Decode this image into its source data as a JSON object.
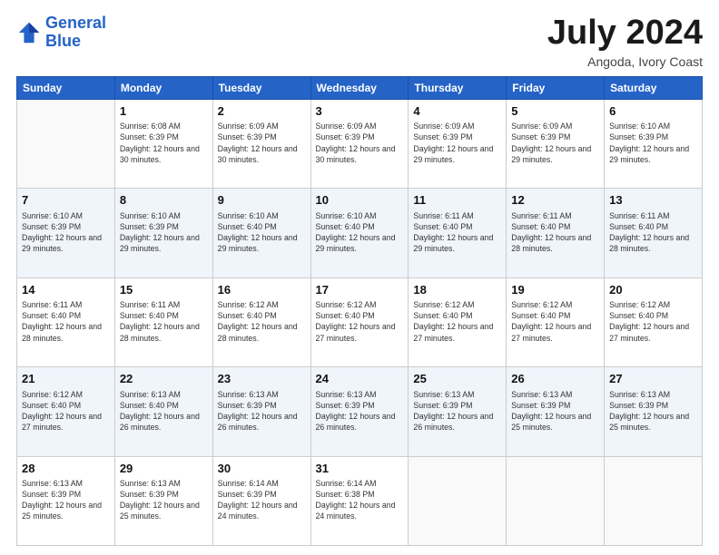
{
  "logo": {
    "line1": "General",
    "line2": "Blue"
  },
  "header": {
    "month": "July 2024",
    "location": "Angoda, Ivory Coast"
  },
  "weekdays": [
    "Sunday",
    "Monday",
    "Tuesday",
    "Wednesday",
    "Thursday",
    "Friday",
    "Saturday"
  ],
  "weeks": [
    [
      {
        "day": null
      },
      {
        "day": 1,
        "sunrise": "6:08 AM",
        "sunset": "6:39 PM",
        "daylight": "12 hours and 30 minutes."
      },
      {
        "day": 2,
        "sunrise": "6:09 AM",
        "sunset": "6:39 PM",
        "daylight": "12 hours and 30 minutes."
      },
      {
        "day": 3,
        "sunrise": "6:09 AM",
        "sunset": "6:39 PM",
        "daylight": "12 hours and 30 minutes."
      },
      {
        "day": 4,
        "sunrise": "6:09 AM",
        "sunset": "6:39 PM",
        "daylight": "12 hours and 29 minutes."
      },
      {
        "day": 5,
        "sunrise": "6:09 AM",
        "sunset": "6:39 PM",
        "daylight": "12 hours and 29 minutes."
      },
      {
        "day": 6,
        "sunrise": "6:10 AM",
        "sunset": "6:39 PM",
        "daylight": "12 hours and 29 minutes."
      }
    ],
    [
      {
        "day": 7,
        "sunrise": "6:10 AM",
        "sunset": "6:39 PM",
        "daylight": "12 hours and 29 minutes."
      },
      {
        "day": 8,
        "sunrise": "6:10 AM",
        "sunset": "6:39 PM",
        "daylight": "12 hours and 29 minutes."
      },
      {
        "day": 9,
        "sunrise": "6:10 AM",
        "sunset": "6:40 PM",
        "daylight": "12 hours and 29 minutes."
      },
      {
        "day": 10,
        "sunrise": "6:10 AM",
        "sunset": "6:40 PM",
        "daylight": "12 hours and 29 minutes."
      },
      {
        "day": 11,
        "sunrise": "6:11 AM",
        "sunset": "6:40 PM",
        "daylight": "12 hours and 29 minutes."
      },
      {
        "day": 12,
        "sunrise": "6:11 AM",
        "sunset": "6:40 PM",
        "daylight": "12 hours and 28 minutes."
      },
      {
        "day": 13,
        "sunrise": "6:11 AM",
        "sunset": "6:40 PM",
        "daylight": "12 hours and 28 minutes."
      }
    ],
    [
      {
        "day": 14,
        "sunrise": "6:11 AM",
        "sunset": "6:40 PM",
        "daylight": "12 hours and 28 minutes."
      },
      {
        "day": 15,
        "sunrise": "6:11 AM",
        "sunset": "6:40 PM",
        "daylight": "12 hours and 28 minutes."
      },
      {
        "day": 16,
        "sunrise": "6:12 AM",
        "sunset": "6:40 PM",
        "daylight": "12 hours and 28 minutes."
      },
      {
        "day": 17,
        "sunrise": "6:12 AM",
        "sunset": "6:40 PM",
        "daylight": "12 hours and 27 minutes."
      },
      {
        "day": 18,
        "sunrise": "6:12 AM",
        "sunset": "6:40 PM",
        "daylight": "12 hours and 27 minutes."
      },
      {
        "day": 19,
        "sunrise": "6:12 AM",
        "sunset": "6:40 PM",
        "daylight": "12 hours and 27 minutes."
      },
      {
        "day": 20,
        "sunrise": "6:12 AM",
        "sunset": "6:40 PM",
        "daylight": "12 hours and 27 minutes."
      }
    ],
    [
      {
        "day": 21,
        "sunrise": "6:12 AM",
        "sunset": "6:40 PM",
        "daylight": "12 hours and 27 minutes."
      },
      {
        "day": 22,
        "sunrise": "6:13 AM",
        "sunset": "6:40 PM",
        "daylight": "12 hours and 26 minutes."
      },
      {
        "day": 23,
        "sunrise": "6:13 AM",
        "sunset": "6:39 PM",
        "daylight": "12 hours and 26 minutes."
      },
      {
        "day": 24,
        "sunrise": "6:13 AM",
        "sunset": "6:39 PM",
        "daylight": "12 hours and 26 minutes."
      },
      {
        "day": 25,
        "sunrise": "6:13 AM",
        "sunset": "6:39 PM",
        "daylight": "12 hours and 26 minutes."
      },
      {
        "day": 26,
        "sunrise": "6:13 AM",
        "sunset": "6:39 PM",
        "daylight": "12 hours and 25 minutes."
      },
      {
        "day": 27,
        "sunrise": "6:13 AM",
        "sunset": "6:39 PM",
        "daylight": "12 hours and 25 minutes."
      }
    ],
    [
      {
        "day": 28,
        "sunrise": "6:13 AM",
        "sunset": "6:39 PM",
        "daylight": "12 hours and 25 minutes."
      },
      {
        "day": 29,
        "sunrise": "6:13 AM",
        "sunset": "6:39 PM",
        "daylight": "12 hours and 25 minutes."
      },
      {
        "day": 30,
        "sunrise": "6:14 AM",
        "sunset": "6:39 PM",
        "daylight": "12 hours and 24 minutes."
      },
      {
        "day": 31,
        "sunrise": "6:14 AM",
        "sunset": "6:38 PM",
        "daylight": "12 hours and 24 minutes."
      },
      {
        "day": null
      },
      {
        "day": null
      },
      {
        "day": null
      }
    ]
  ]
}
